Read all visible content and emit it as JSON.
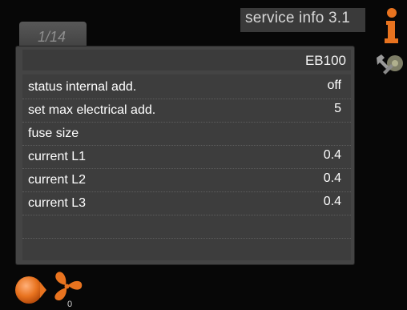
{
  "header": {
    "title": "service info  3.1"
  },
  "tab": {
    "label": "1/14"
  },
  "panel": {
    "title": "EB100"
  },
  "rows": [
    {
      "label": "status internal add.",
      "value": "off"
    },
    {
      "label": "set max electrical add.",
      "value": "5"
    },
    {
      "label": "fuse size",
      "value": ""
    },
    {
      "label": "current L1",
      "value": "0.4"
    },
    {
      "label": "current L2",
      "value": "0.4"
    },
    {
      "label": "current L3",
      "value": "0.4"
    }
  ],
  "footer": {
    "fan_speed": "0"
  },
  "icons": {
    "info": "info-icon",
    "tools": "tools-icon",
    "fan": "fan-icon",
    "heating": "heating-icon"
  },
  "colors": {
    "accent": "#e8731f"
  }
}
